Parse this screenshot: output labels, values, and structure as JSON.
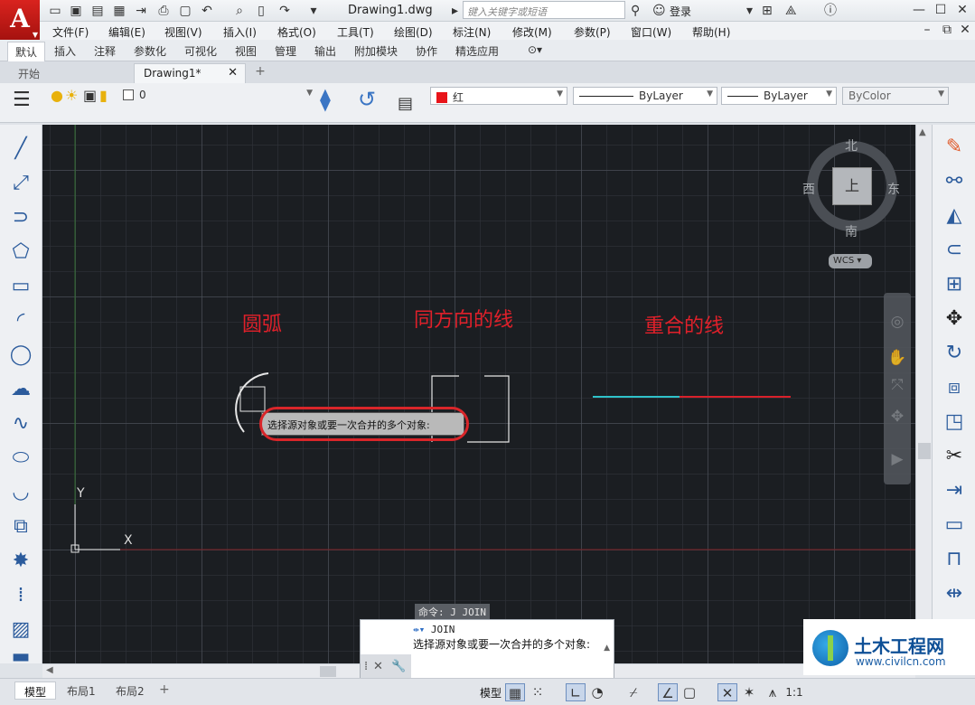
{
  "titlebar": {
    "app_logo": "A",
    "document_title": "Drawing1.dwg",
    "search_placeholder": "键入关键字或短语",
    "login_label": "登录"
  },
  "menu": [
    "文件(F)",
    "编辑(E)",
    "视图(V)",
    "插入(I)",
    "格式(O)",
    "工具(T)",
    "绘图(D)",
    "标注(N)",
    "修改(M)",
    "参数(P)",
    "窗口(W)",
    "帮助(H)"
  ],
  "ribbon_tabs": [
    "默认",
    "插入",
    "注释",
    "参数化",
    "可视化",
    "视图",
    "管理",
    "输出",
    "附加模块",
    "协作",
    "精选应用"
  ],
  "doc_tabs": {
    "start": "开始",
    "drawing": "Drawing1*"
  },
  "properties": {
    "layer": "0",
    "color": "红",
    "color_hex": "#e8141a",
    "linetype": "ByLayer",
    "lineweight": "ByLayer",
    "plotstyle": "ByColor"
  },
  "canvas": {
    "labels": {
      "arc": "圆弧",
      "same_direction": "同方向的线",
      "overlap": "重合的线"
    },
    "ucs_x": "X",
    "ucs_y": "Y",
    "prompt": "选择源对象或要一次合并的多个对象:",
    "command_echo": "命令: J JOIN"
  },
  "viewcube": {
    "north": "北",
    "south": "南",
    "west": "西",
    "east": "东",
    "face": "上",
    "wcs": "WCS"
  },
  "command_line": {
    "command": "JOIN",
    "text": "选择源对象或要一次合并的多个对象:"
  },
  "status": {
    "model_tab": "模型",
    "layout1": "布局1",
    "layout2": "布局2",
    "model_label": "模型",
    "scale": "1:1"
  },
  "watermark": {
    "title": "土木工程网",
    "url": "www.civilcn.com"
  }
}
